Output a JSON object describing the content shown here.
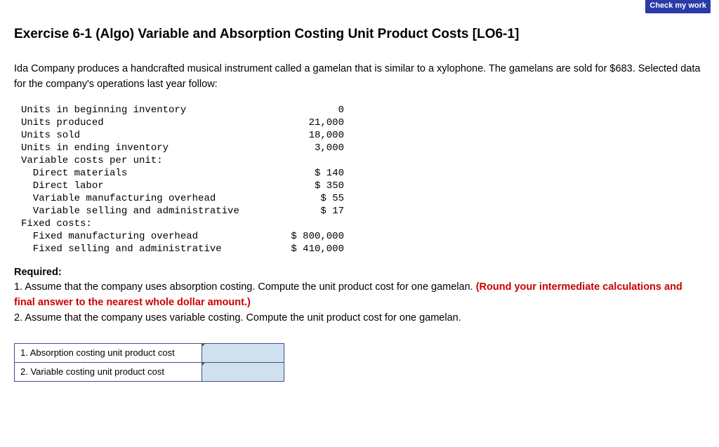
{
  "button": {
    "check_label": "Check my work"
  },
  "title": "Exercise 6-1 (Algo) Variable and Absorption Costing Unit Product Costs [LO6-1]",
  "intro": "Ida Company produces a handcrafted musical instrument called a gamelan that is similar to a xylophone. The gamelans are sold for $683. Selected data for the company's operations last year follow:",
  "data_rows": [
    {
      "label": "Units in beginning inventory",
      "value": "0"
    },
    {
      "label": "Units produced",
      "value": "21,000"
    },
    {
      "label": "Units sold",
      "value": "18,000"
    },
    {
      "label": "Units in ending inventory",
      "value": "3,000"
    },
    {
      "label": "Variable costs per unit:",
      "value": ""
    },
    {
      "label": "  Direct materials",
      "value": "$ 140"
    },
    {
      "label": "  Direct labor",
      "value": "$ 350"
    },
    {
      "label": "  Variable manufacturing overhead",
      "value": "$ 55"
    },
    {
      "label": "  Variable selling and administrative",
      "value": "$ 17"
    },
    {
      "label": "Fixed costs:",
      "value": ""
    },
    {
      "label": "  Fixed manufacturing overhead",
      "value": "$ 800,000"
    },
    {
      "label": "  Fixed selling and administrative",
      "value": "$ 410,000"
    }
  ],
  "required_label": "Required:",
  "req1": {
    "black1": "1. Assume that the company uses absorption costing. Compute the unit product cost for one gamelan. ",
    "red": "(Round your intermediate calculations and final answer to the nearest whole dollar amount.)"
  },
  "req2": "2. Assume that the company uses variable costing. Compute the unit product cost for one gamelan.",
  "answers": {
    "row1_label": "1. Absorption costing unit product cost",
    "row2_label": "2. Variable costing unit product cost"
  }
}
